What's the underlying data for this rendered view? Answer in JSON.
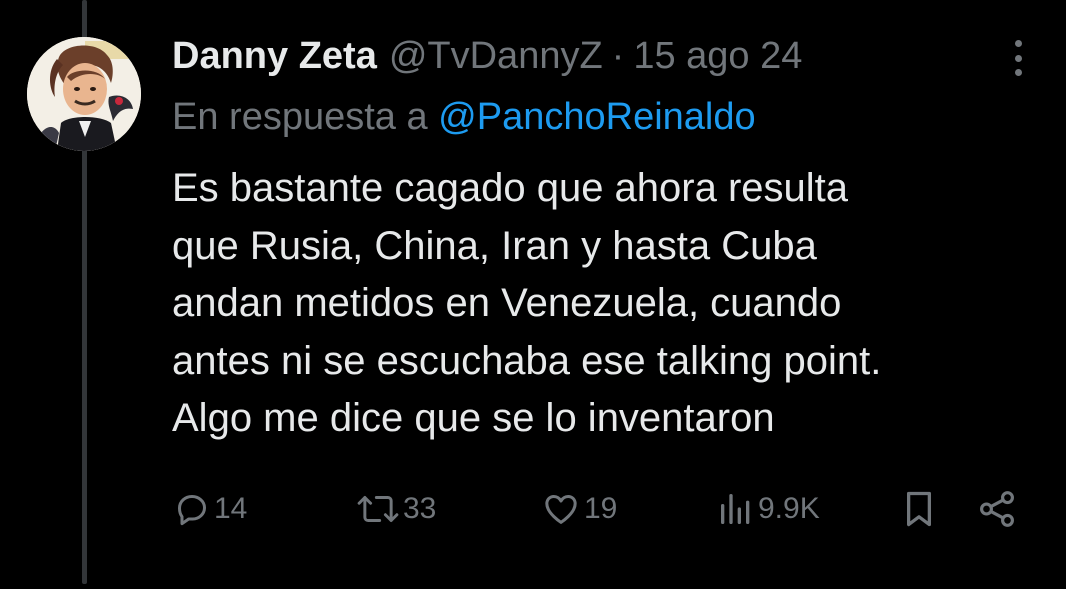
{
  "tweet": {
    "author_name": "Danny Zeta",
    "handle": "@TvDannyZ",
    "separator": "·",
    "date": "15 ago 24",
    "reply_prefix": "En respuesta a",
    "reply_mention": "@PanchoReinaldo",
    "text": "Es bastante cagado que ahora resulta\nque Rusia, China, Iran y hasta Cuba\nandan metidos en Venezuela, cuando\nantes ni se escuchaba ese talking point.\nAlgo me dice que se lo inventaron"
  },
  "actions": {
    "replies": "14",
    "reposts": "33",
    "likes": "19",
    "views": "9.9K"
  },
  "icons": {
    "reply": "reply-icon",
    "repost": "repost-icon",
    "like": "heart-icon",
    "views": "views-icon",
    "bookmark": "bookmark-icon",
    "share": "share-icon",
    "more": "more-icon"
  },
  "colors": {
    "background": "#000000",
    "text": "#e7e9ea",
    "muted": "#71767b",
    "link": "#1d9bf0",
    "thread_line": "#333639"
  }
}
